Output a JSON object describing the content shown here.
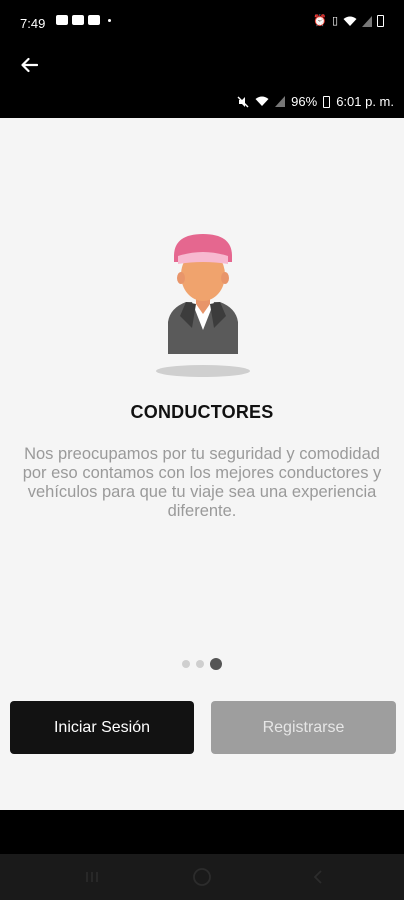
{
  "status_bar": {
    "time": "7:49",
    "right_icons": [
      "alarm-icon",
      "vibrate-icon",
      "wifi-icon",
      "signal-icon",
      "battery-icon"
    ]
  },
  "app_bar": {
    "back_icon": "arrow-left-icon",
    "inner_status": {
      "battery": "96%",
      "time": "6:01 p. m."
    }
  },
  "onboarding": {
    "title": "CONDUCTORES",
    "description": "Nos preocupamos por tu seguridad y comodidad por eso contamos con los mejores conductores y vehículos para que tu viaje sea una experiencia diferente.",
    "pager": {
      "total": 3,
      "active_index": 2
    }
  },
  "buttons": {
    "login": "Iniciar Sesión",
    "register": "Registrarse"
  },
  "colors": {
    "cap_pink": "#e5678f",
    "skin": "#f0a36d",
    "jacket": "#5a5a5a",
    "login_bg": "#121212",
    "register_bg": "#9e9e9e"
  }
}
